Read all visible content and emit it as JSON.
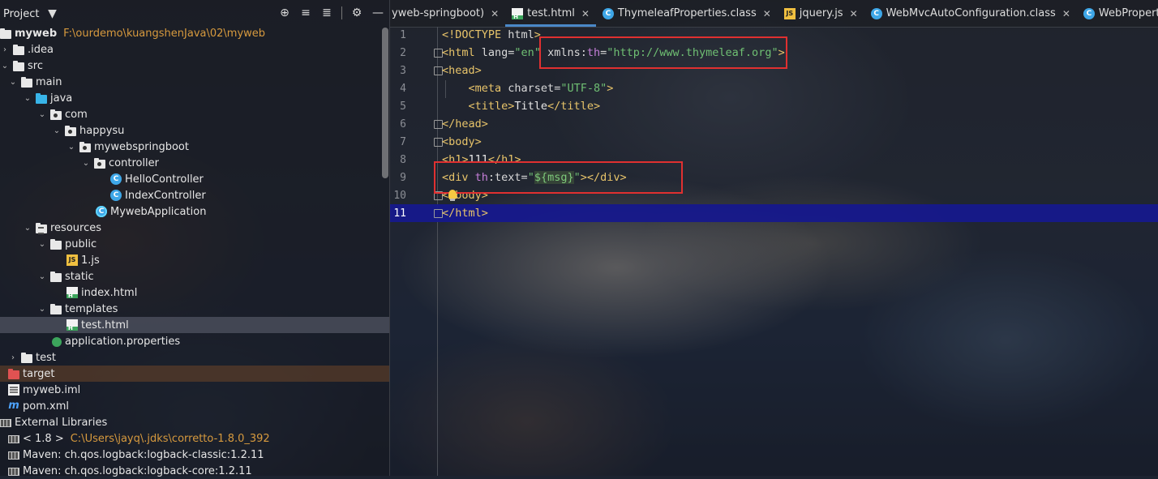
{
  "project_panel": {
    "title": "Project",
    "tree": [
      {
        "label": "myweb",
        "hint": "F:\\ourdemo\\kuangshenJava\\02\\myweb"
      },
      {
        "label": ".idea"
      },
      {
        "label": "src"
      },
      {
        "label": "main"
      },
      {
        "label": "java"
      },
      {
        "label": "com"
      },
      {
        "label": "happysu"
      },
      {
        "label": "mywebspringboot"
      },
      {
        "label": "controller"
      },
      {
        "label": "HelloController"
      },
      {
        "label": "IndexController"
      },
      {
        "label": "MywebApplication"
      },
      {
        "label": "resources"
      },
      {
        "label": "public"
      },
      {
        "label": "1.js"
      },
      {
        "label": "static"
      },
      {
        "label": "index.html"
      },
      {
        "label": "templates"
      },
      {
        "label": "test.html"
      },
      {
        "label": "application.properties"
      },
      {
        "label": "test"
      },
      {
        "label": "target"
      },
      {
        "label": "myweb.iml"
      },
      {
        "label": "pom.xml"
      },
      {
        "label": "External Libraries"
      },
      {
        "label": "< 1.8 >",
        "hint": "C:\\Users\\jayq\\.jdks\\corretto-1.8.0_392"
      },
      {
        "label": "Maven: ch.qos.logback:logback-classic:1.2.11"
      },
      {
        "label": "Maven: ch.qos.logback:logback-core:1.2.11"
      }
    ]
  },
  "tabs": [
    {
      "label": "yweb-springboot)"
    },
    {
      "label": "test.html"
    },
    {
      "label": "ThymeleafProperties.class"
    },
    {
      "label": "jquery.js"
    },
    {
      "label": "WebMvcAutoConfiguration.class"
    },
    {
      "label": "WebProperties.class"
    }
  ],
  "editor": {
    "current_line": 11,
    "lines": [
      {
        "no": "1",
        "tokens": [
          {
            "t": "<!DOCTYPE",
            "c": "t-tag"
          },
          {
            "t": " html",
            "c": "t-attr"
          },
          {
            "t": ">",
            "c": "t-tag"
          }
        ]
      },
      {
        "no": "2",
        "tokens": [
          {
            "t": "<html",
            "c": "t-tag"
          },
          {
            "t": " lang",
            "c": "t-attr"
          },
          {
            "t": "=",
            "c": "t-attr"
          },
          {
            "t": "\"en\"",
            "c": "t-val"
          },
          {
            "t": " xmlns:",
            "c": "t-attr"
          },
          {
            "t": "th",
            "c": "t-th"
          },
          {
            "t": "=",
            "c": "t-attr"
          },
          {
            "t": "\"http://www.thymeleaf.org\"",
            "c": "t-val"
          },
          {
            "t": ">",
            "c": "t-tag"
          }
        ]
      },
      {
        "no": "3",
        "tokens": [
          {
            "t": "<head>",
            "c": "t-tag"
          }
        ]
      },
      {
        "no": "4",
        "tokens": [
          {
            "t": "    <meta",
            "c": "t-tag"
          },
          {
            "t": " charset",
            "c": "t-attr"
          },
          {
            "t": "=",
            "c": "t-attr"
          },
          {
            "t": "\"UTF-8\"",
            "c": "t-val"
          },
          {
            "t": ">",
            "c": "t-tag"
          }
        ]
      },
      {
        "no": "5",
        "tokens": [
          {
            "t": "    <title>",
            "c": "t-tag"
          },
          {
            "t": "Title",
            "c": "t-text"
          },
          {
            "t": "</title>",
            "c": "t-tag"
          }
        ]
      },
      {
        "no": "6",
        "tokens": [
          {
            "t": "</head>",
            "c": "t-tag"
          }
        ]
      },
      {
        "no": "7",
        "tokens": [
          {
            "t": "<body>",
            "c": "t-tag"
          }
        ]
      },
      {
        "no": "8",
        "tokens": [
          {
            "t": "<h1>",
            "c": "t-tag"
          },
          {
            "t": "111",
            "c": "t-text"
          },
          {
            "t": "</h1>",
            "c": "t-tag"
          }
        ]
      },
      {
        "no": "9",
        "tokens": [
          {
            "t": "<div",
            "c": "t-tag"
          },
          {
            "t": " th",
            "c": "t-th"
          },
          {
            "t": ":text",
            "c": "t-attr"
          },
          {
            "t": "=",
            "c": "t-attr"
          },
          {
            "t": "\"",
            "c": "t-val"
          },
          {
            "t": "${msg}",
            "c": "t-expr"
          },
          {
            "t": "\"",
            "c": "t-val"
          },
          {
            "t": "></div>",
            "c": "t-tag"
          }
        ]
      },
      {
        "no": "10",
        "tokens": [
          {
            "t": "</body>",
            "c": "t-tag"
          }
        ]
      },
      {
        "no": "11",
        "tokens": [
          {
            "t": "</html>",
            "c": "t-tag"
          }
        ]
      }
    ]
  },
  "colors": {
    "current_line": "#16188c",
    "highlight_box": "#e03030",
    "tab_underline": "#4a88c7"
  },
  "icons": [
    "target-icon",
    "collapse-all-icon",
    "expand-all-icon",
    "gear-icon",
    "minimize-icon",
    "chevron-down-icon",
    "close-icon"
  ]
}
